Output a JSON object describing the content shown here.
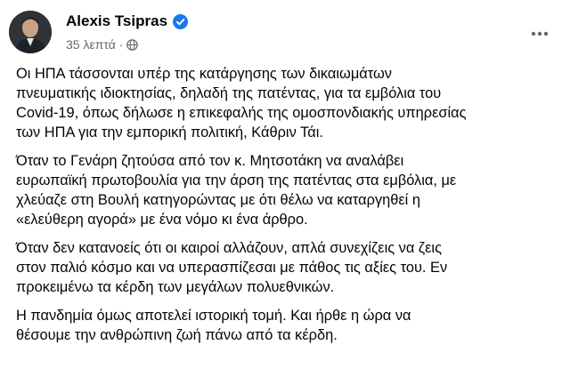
{
  "post": {
    "author": "Alexis Tsipras",
    "timestamp": "35 λεπτά",
    "separator": "·",
    "verified": true,
    "icons": {
      "verified": "verified-badge-icon",
      "audience": "globe-icon",
      "more": "more-options-icon"
    },
    "colors": {
      "verified": "#1877f2",
      "secondary_text": "#65676b"
    },
    "paragraphs": [
      "Οι ΗΠΑ τάσσονται υπέρ της κατάργησης των δικαιωμάτων\nπνευματικής ιδιοκτησίας, δηλαδή της πατέντας, για τα εμβόλια του\nCovid-19, όπως δήλωσε η επικεφαλής της ομοσπονδιακής υπηρεσίας\nτων ΗΠΑ για την εμπορική πολιτική, Κάθριν Τάι.",
      "Όταν το Γενάρη ζητούσα από τον κ. Μητσοτάκη να αναλάβει\nευρωπαϊκή πρωτοβουλία για την άρση της πατέντας στα εμβόλια, με\nχλεύαζε στη Βουλή κατηγορώντας με ότι θέλω να καταργηθεί η\n«ελεύθερη αγορά» με ένα νόμο κι ένα άρθρο.",
      "Όταν δεν κατανοείς ότι οι καιροί αλλάζουν, απλά συνεχίζεις να ζεις\nστον παλιό κόσμο και να υπερασπίζεσαι με πάθος τις αξίες του. Εν\nπροκειμένω τα κέρδη των μεγάλων πολυεθνικών.",
      "Η πανδημία όμως αποτελεί ιστορική τομή. Και ήρθε η ώρα να\nθέσουμε την ανθρώπινη ζωή πάνω από τα κέρδη."
    ]
  }
}
